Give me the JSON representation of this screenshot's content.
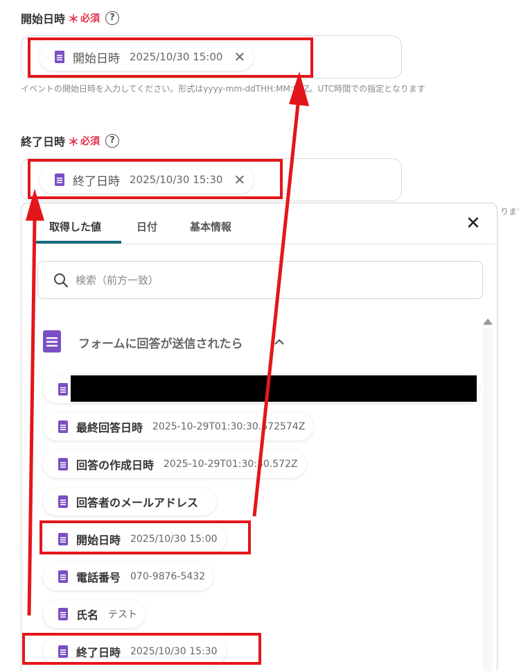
{
  "start_field": {
    "label": "開始日時",
    "required_star": "＊",
    "required_text": "必須",
    "help": "?",
    "chip": {
      "label": "開始日時",
      "value": "2025/10/30 15:00",
      "remove": "✕"
    },
    "hint": "イベントの開始日時を入力してください。形式はyyyy-mm-ddTHH:MM:SSZ。UTC時間での指定となります"
  },
  "end_field": {
    "label": "終了日時",
    "required_star": "＊",
    "required_text": "必須",
    "help": "?",
    "chip": {
      "label": "終了日時",
      "value": "2025/10/30 15:30",
      "remove": "✕"
    },
    "hint_tail": "ります"
  },
  "panel": {
    "tabs": [
      {
        "label": "取得した値",
        "active": true
      },
      {
        "label": "日付",
        "active": false
      },
      {
        "label": "基本情報",
        "active": false
      }
    ],
    "close": "✕",
    "search": {
      "placeholder": "検索（前方一致）"
    },
    "section": {
      "title": "フォームに回答が送信されたら",
      "chevron": "^"
    },
    "items": [
      {
        "label": "",
        "value": ""
      },
      {
        "label": "最終回答日時",
        "value": "2025-10-29T01:30:30.572574Z"
      },
      {
        "label": "回答の作成日時",
        "value": "2025-10-29T01:30:30.572Z"
      },
      {
        "label": "回答者のメールアドレス",
        "value": ""
      },
      {
        "label": "開始日時",
        "value": "2025/10/30 15:00"
      },
      {
        "label": "電話番号",
        "value": "070-9876-5432"
      },
      {
        "label": "氏名",
        "value": "テスト"
      },
      {
        "label": "終了日時",
        "value": "2025/10/30 15:30"
      }
    ]
  },
  "colors": {
    "accent": "#166b7c",
    "required": "#e0314b",
    "annotation": "#e3161b",
    "doc_icon": "#7b4fc4"
  }
}
